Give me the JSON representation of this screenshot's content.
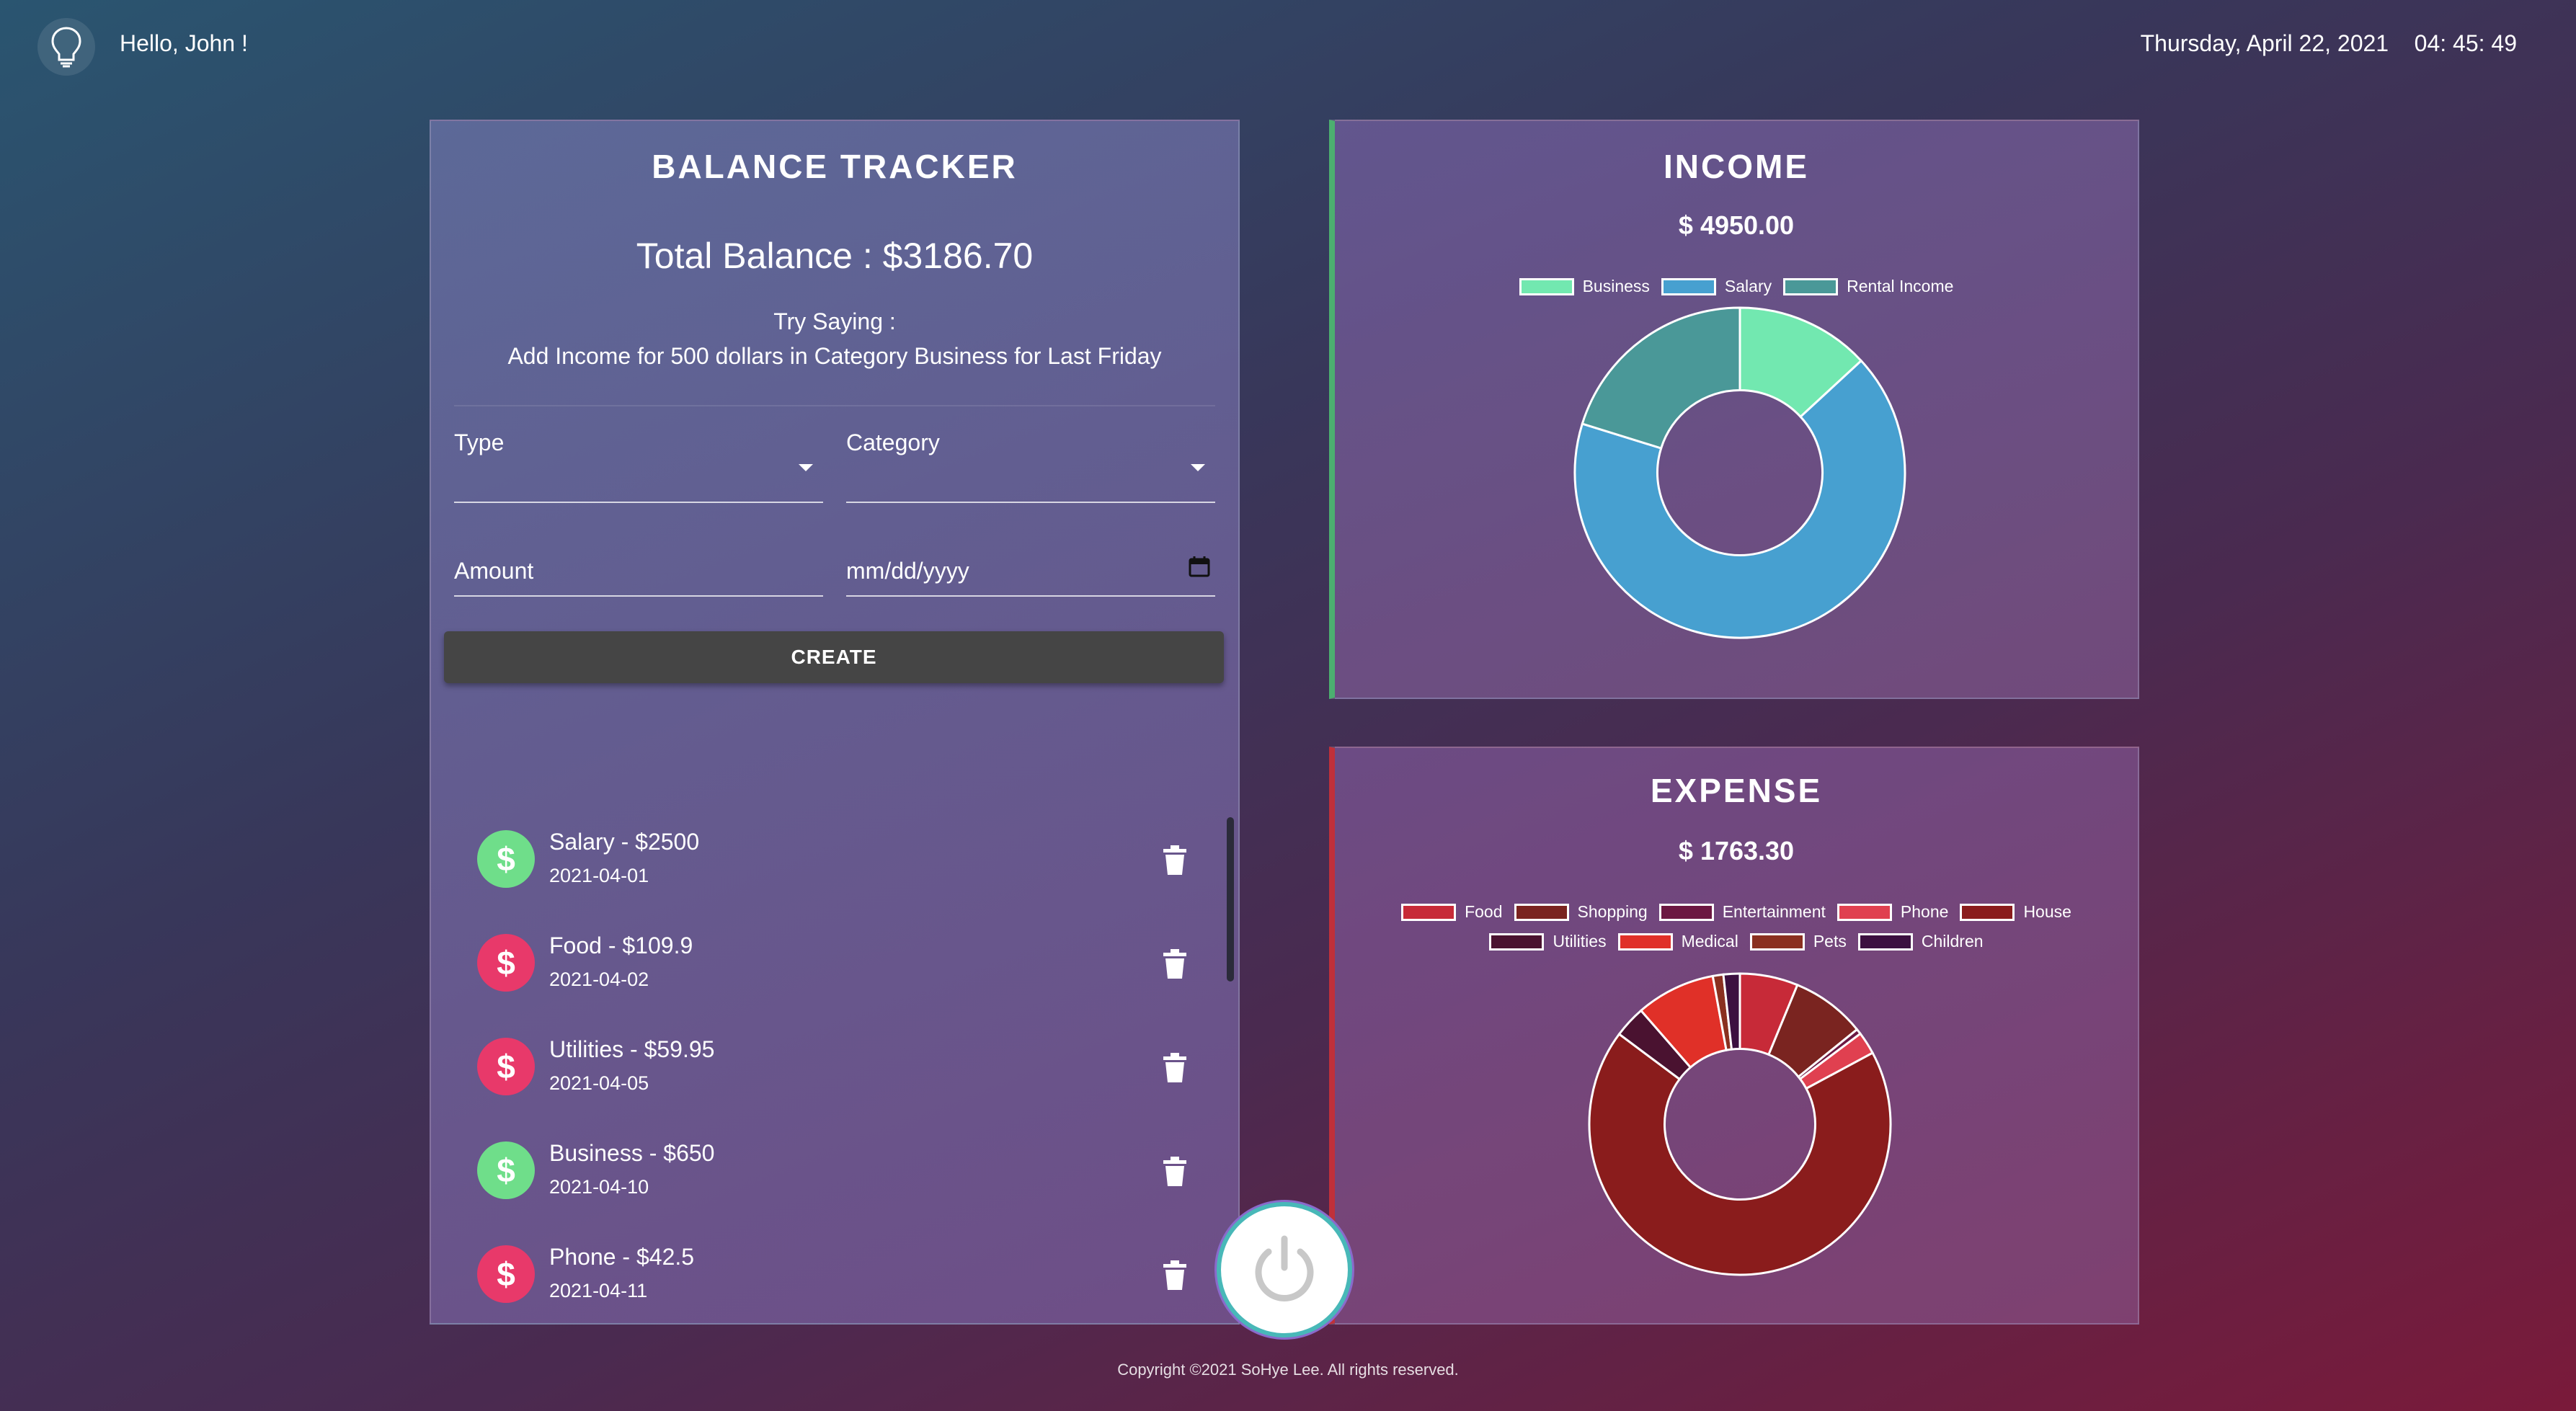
{
  "header": {
    "greeting": "Hello, John !",
    "date": "Thursday, April 22, 2021",
    "time": "04: 45: 49",
    "icon": "lightbulb-icon"
  },
  "tracker": {
    "title": "BALANCE TRACKER",
    "total_balance": "Total Balance : $3186.70",
    "try_saying_label": "Try Saying :",
    "try_saying_example": "Add Income for 500 dollars in Category Business for Last Friday",
    "type_label": "Type",
    "category_label": "Category",
    "amount_label": "Amount",
    "date_placeholder": "mm/dd/yyyy",
    "create_label": "CREATE",
    "transactions": [
      {
        "text": "Salary - $2500",
        "date": "2021-04-01",
        "kind": "income"
      },
      {
        "text": "Food - $109.9",
        "date": "2021-04-02",
        "kind": "expense"
      },
      {
        "text": "Utilities - $59.95",
        "date": "2021-04-05",
        "kind": "expense"
      },
      {
        "text": "Business - $650",
        "date": "2021-04-10",
        "kind": "income"
      },
      {
        "text": "Phone - $42.5",
        "date": "2021-04-11",
        "kind": "expense"
      }
    ],
    "avatar_symbol": "$",
    "colors": {
      "income": "#6fde8a",
      "expense": "#e8396a"
    }
  },
  "income": {
    "title": "INCOME",
    "total": "$ 4950.00"
  },
  "expense": {
    "title": "EXPENSE",
    "total": "$ 1763.30"
  },
  "footer": {
    "copyright": "Copyright ©2021 SoHye Lee. All rights reserved."
  },
  "chart_data": [
    {
      "type": "doughnut",
      "labels": [
        "Business",
        "Salary",
        "Rental Income"
      ],
      "values": [
        650,
        3300,
        1000
      ],
      "colors": [
        "#72e8b0",
        "#47a0d0",
        "#4a9898"
      ],
      "legend": "top"
    },
    {
      "type": "doughnut",
      "labels": [
        "Food",
        "Shopping",
        "Entertainment",
        "Phone",
        "House",
        "Utilities",
        "Medical",
        "Pets",
        "Children"
      ],
      "values": [
        109.9,
        140,
        10,
        42.5,
        1200,
        59.95,
        150,
        20,
        30.95
      ],
      "colors": [
        "#c72a38",
        "#7a2420",
        "#6c1842",
        "#e04050",
        "#8a1c1c",
        "#4a1230",
        "#e03028",
        "#8a3020",
        "#3c1040"
      ],
      "legend": "top"
    }
  ]
}
